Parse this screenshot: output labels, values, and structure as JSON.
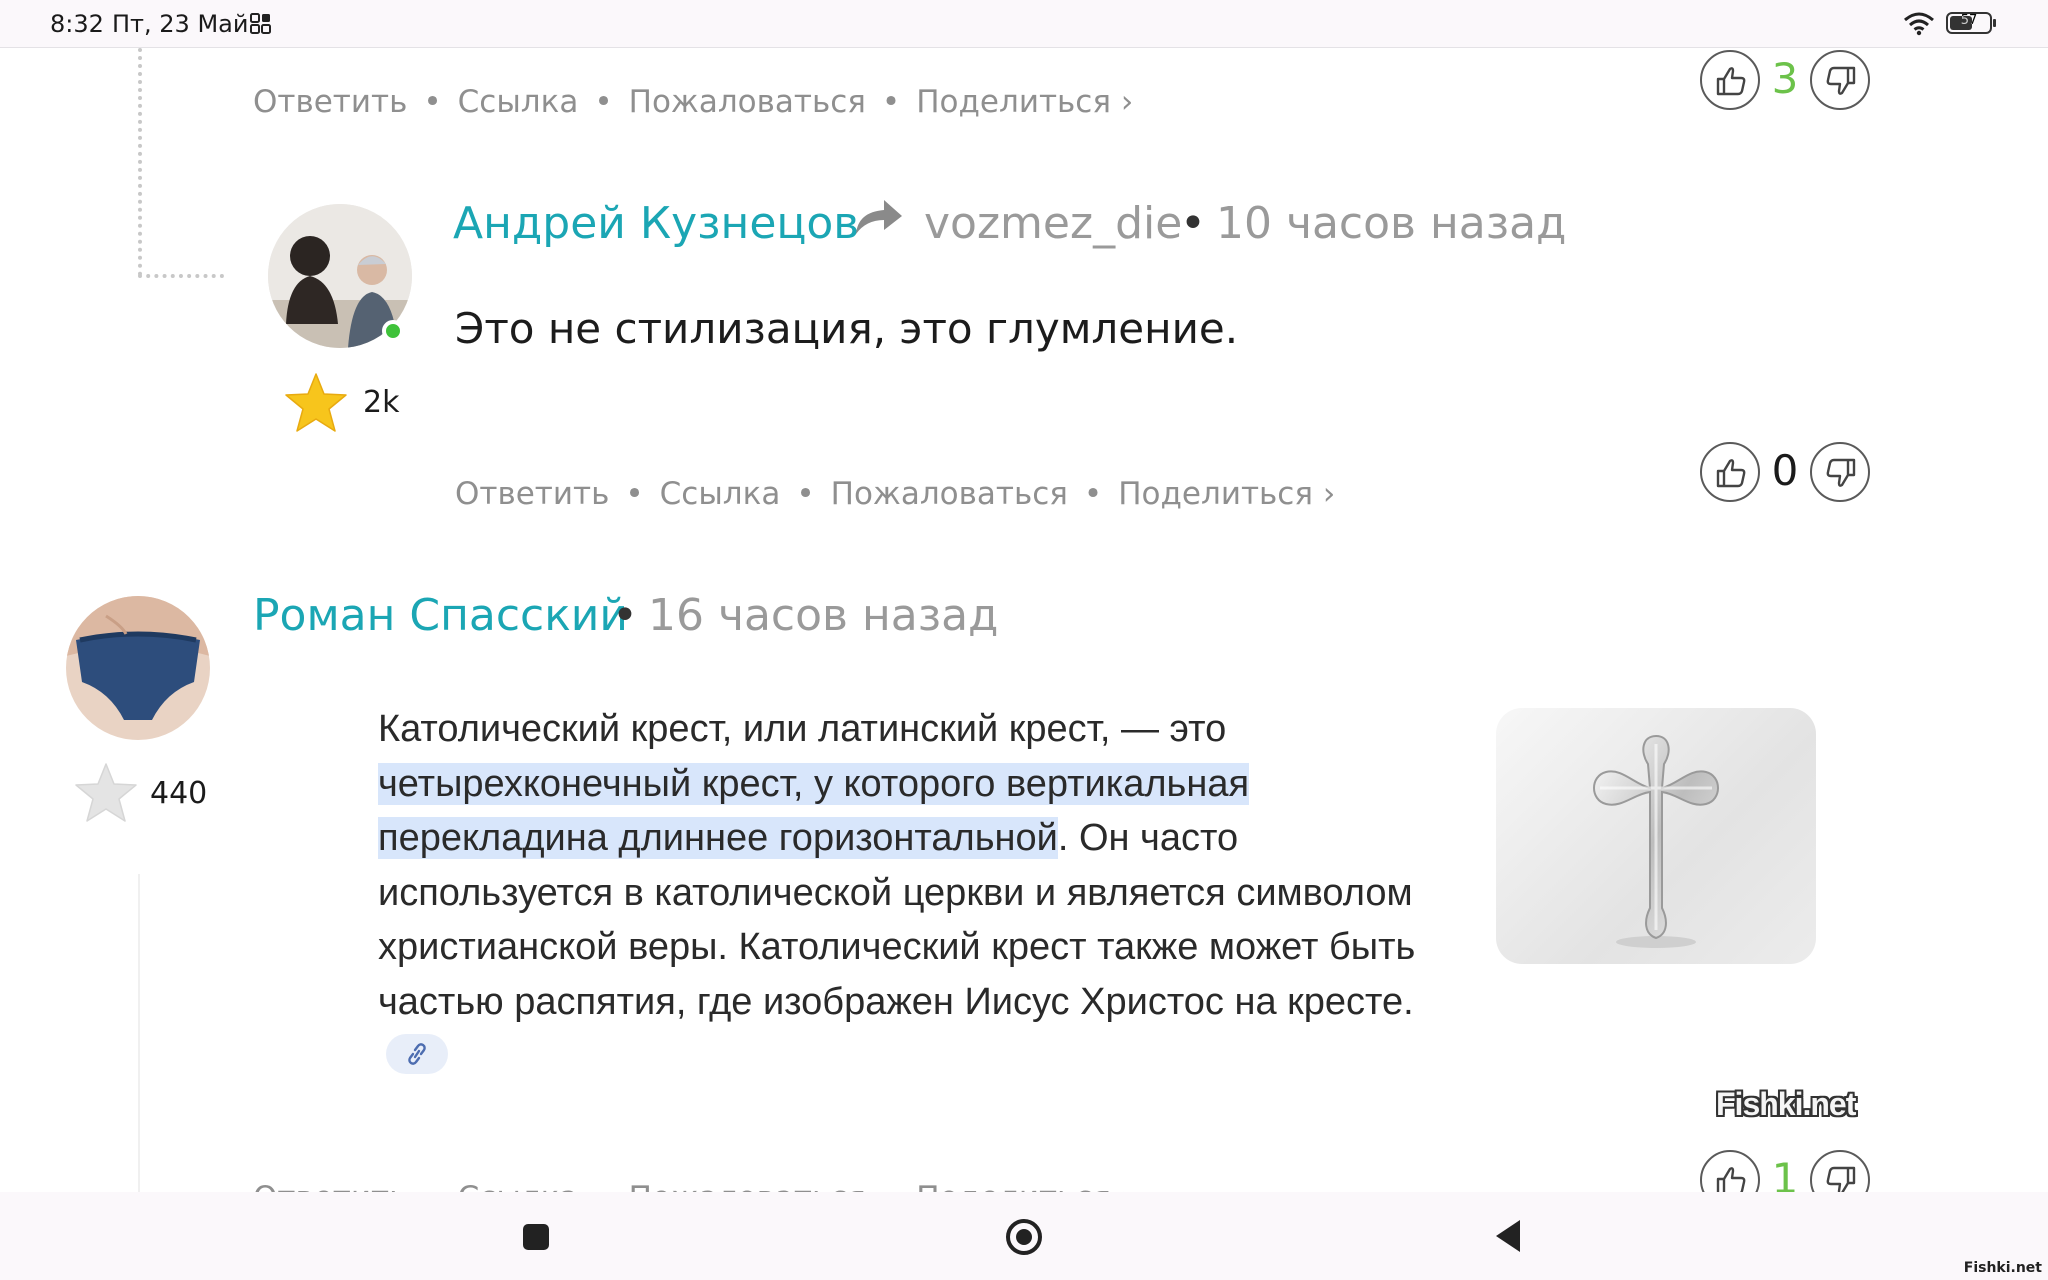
{
  "status_bar": {
    "time": "8:32",
    "date": "Пт, 23 Май",
    "battery": "57"
  },
  "action_labels": {
    "reply": "Ответить",
    "link": "Ссылка",
    "report": "Пожаловаться",
    "share": "Поделиться ›",
    "separator": "•"
  },
  "comments": [
    {
      "votes": "3",
      "vote_color": "#6cc24a"
    },
    {
      "author": "Андрей Кузнецов",
      "reply_to": "vozmez_die",
      "separator": "•",
      "time_ago": "10 часов назад",
      "text": "Это не стилизация, это глумление.",
      "rating": "2k",
      "votes": "0",
      "vote_color": "#1b1b1b"
    },
    {
      "author": "Роман Спасский",
      "separator": "•",
      "time_ago": "16 часов назад",
      "rating": "440",
      "votes": "1",
      "vote_color": "#6cc24a",
      "embed": {
        "line1_pre": "Католический крест, или латинский крест, — это ",
        "highlight": "четырехконечный крест, у которого вертикальная перекладина длиннее горизонтальной",
        "rest": ". Он часто используется в католической церкви и является символом христианской веры. Католический крест также может быть частью распятия, где изображен Иисус Христос на кресте."
      },
      "watermark": "Fishki.net"
    }
  ],
  "corner_watermark": "Fishki.net",
  "colors": {
    "author": "#1ba6b4",
    "meta": "#9a9a9a",
    "action": "#8f8f8f",
    "online": "#3fc23a",
    "highlight": "#d8e6fb"
  }
}
